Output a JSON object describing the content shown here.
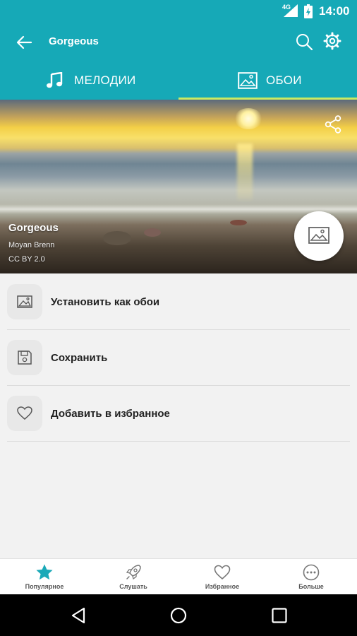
{
  "status_bar": {
    "network": "4G",
    "time": "14:00"
  },
  "app_bar": {
    "title": "Gorgeous"
  },
  "tabs": [
    {
      "label": "МЕЛОДИИ",
      "icon": "music-note-icon"
    },
    {
      "label": "ОБОИ",
      "icon": "image-icon",
      "active": true
    }
  ],
  "wallpaper": {
    "title": "Gorgeous",
    "author": "Moyan Brenn",
    "license": "CC BY 2.0"
  },
  "actions": [
    {
      "label": "Установить как обои",
      "icon": "image-icon"
    },
    {
      "label": "Сохранить",
      "icon": "save-icon"
    },
    {
      "label": "Добавить в избранное",
      "icon": "heart-icon"
    }
  ],
  "bottom_nav": [
    {
      "label": "Популярное",
      "icon": "star-icon",
      "active": true
    },
    {
      "label": "Слушать",
      "icon": "rocket-icon"
    },
    {
      "label": "Избранное",
      "icon": "heart-icon"
    },
    {
      "label": "Больше",
      "icon": "more-icon"
    }
  ],
  "colors": {
    "primary": "#16a9b7",
    "tab_indicator": "#c9ea63",
    "nav_active": "#1aa9b8"
  }
}
